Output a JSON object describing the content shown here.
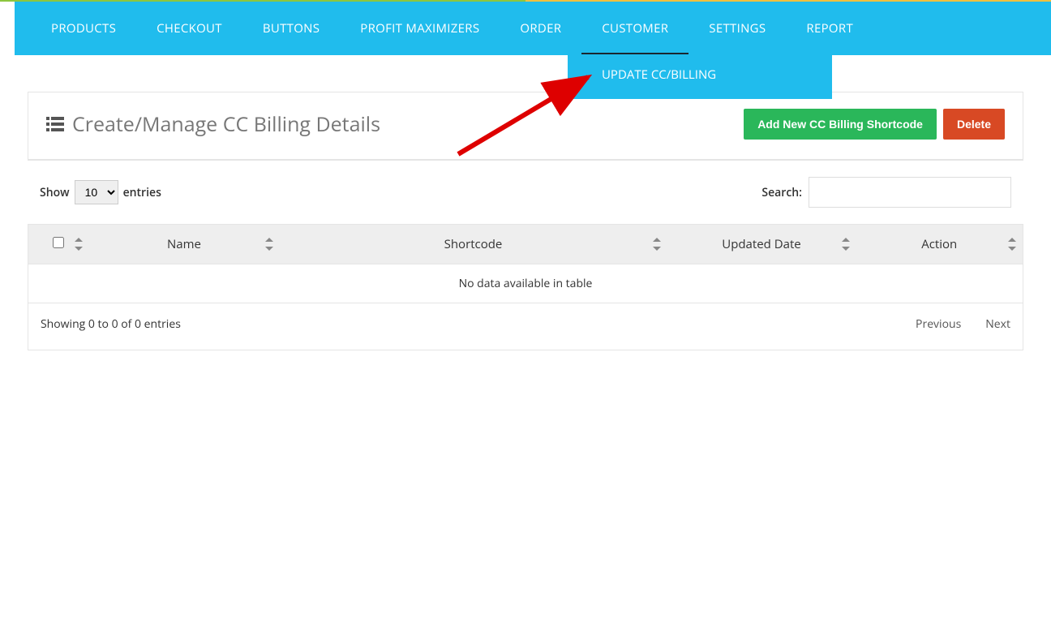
{
  "nav": {
    "items": [
      {
        "label": "PRODUCTS"
      },
      {
        "label": "CHECKOUT"
      },
      {
        "label": "BUTTONS"
      },
      {
        "label": "PROFIT MAXIMIZERS"
      },
      {
        "label": "ORDER"
      },
      {
        "label": "CUSTOMER"
      },
      {
        "label": "SETTINGS"
      },
      {
        "label": "REPORT"
      }
    ],
    "submenu_label": "UPDATE CC/BILLING"
  },
  "panel": {
    "title": "Create/Manage CC Billing Details",
    "add_button": "Add New CC Billing Shortcode",
    "delete_button": "Delete"
  },
  "table_controls": {
    "show_label": "Show",
    "entries_label": "entries",
    "page_size": "10",
    "search_label": "Search:"
  },
  "table": {
    "columns": {
      "name": "Name",
      "shortcode": "Shortcode",
      "updated_date": "Updated Date",
      "action": "Action"
    },
    "empty_text": "No data available in table"
  },
  "footer": {
    "showing": "Showing 0 to 0 of 0 entries",
    "prev": "Previous",
    "next": "Next"
  },
  "colors": {
    "nav_bg": "#20bced",
    "btn_success": "#2ab75a",
    "btn_danger": "#d84924"
  }
}
